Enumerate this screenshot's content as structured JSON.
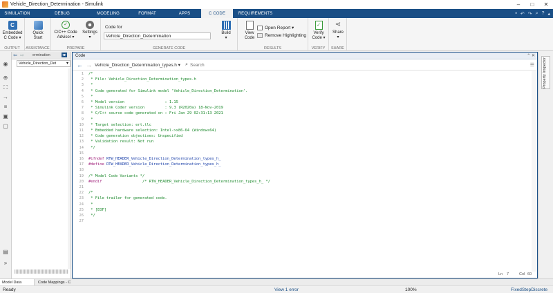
{
  "window": {
    "title": "Vehicle_Direction_Determination - Simulink",
    "controls": [
      "–",
      "□",
      "✕"
    ]
  },
  "tabs": [
    {
      "label": "SIMULATION",
      "active": false
    },
    {
      "label": "DEBUG",
      "active": false
    },
    {
      "label": "MODELING",
      "active": false
    },
    {
      "label": "FORMAT",
      "active": false
    },
    {
      "label": "APPS",
      "active": false
    },
    {
      "label": "C CODE",
      "active": true
    },
    {
      "label": "REQUIREMENTS",
      "active": false
    }
  ],
  "toolstrip": {
    "output": {
      "label": "OUTPUT",
      "embedded_line1": "Embedded",
      "embedded_line2": "C Code ▾"
    },
    "assistance": {
      "label": "ASSISTANCE",
      "quick_line1": "Quick",
      "quick_line2": "Start"
    },
    "prepare": {
      "label": "PREPARE",
      "advisor_line1": "C/C++ Code",
      "advisor_line2": "Advisor ▾",
      "settings_line1": "Settings",
      "settings_line2": "▾"
    },
    "generate": {
      "label": "GENERATE CODE",
      "code_for_label": "Code for",
      "code_for_value": "Vehicle_Direction_Determination",
      "build_line1": "Build",
      "build_line2": "▾"
    },
    "results": {
      "label": "RESULTS",
      "view_line1": "View",
      "view_line2": "Code",
      "open_report": "Open Report ▾",
      "remove_highlighting": "Remove Highlighting"
    },
    "verify": {
      "label": "VERIFY",
      "verify_line1": "Verify",
      "verify_line2": "Code ▾"
    },
    "share": {
      "label": "SHARE",
      "share_line1": "Share",
      "share_line2": "▾"
    }
  },
  "browser": {
    "breadcrumb": "ermination",
    "model_selector": "Vehicle_Direction_Det"
  },
  "code_panel": {
    "header": "Code",
    "file_selector": "Vehicle_Direction_Determination_types.h ▾",
    "search_placeholder": "Search",
    "lines": [
      {
        "n": "1",
        "text": "/*",
        "cls": "c-comment"
      },
      {
        "n": "2",
        "text": " * File: Vehicle_Direction_Determination_types.h",
        "cls": "c-comment"
      },
      {
        "n": "3",
        "text": " *",
        "cls": "c-comment"
      },
      {
        "n": "4",
        "text": " * Code generated for Simulink model 'Vehicle_Direction_Determination'.",
        "cls": "c-comment"
      },
      {
        "n": "5",
        "text": " *",
        "cls": "c-comment"
      },
      {
        "n": "6",
        "text": " * Model version                  : 1.15",
        "cls": "c-comment"
      },
      {
        "n": "7",
        "text": " * Simulink Coder version         : 9.3 (R2020a) 18-Nov-2019",
        "cls": "c-comment"
      },
      {
        "n": "8",
        "text": " * C/C++ source code generated on : Fri Jan 29 02:31:13 2021",
        "cls": "c-comment"
      },
      {
        "n": "9",
        "text": " *",
        "cls": "c-comment"
      },
      {
        "n": "10",
        "text": " * Target selection: ert.tlc",
        "cls": "c-comment"
      },
      {
        "n": "11",
        "text": " * Embedded hardware selection: Intel->x86-64 (Windows64)",
        "cls": "c-comment"
      },
      {
        "n": "12",
        "text": " * Code generation objectives: Unspecified",
        "cls": "c-comment"
      },
      {
        "n": "13",
        "text": " * Validation result: Not run",
        "cls": "c-comment"
      },
      {
        "n": "14",
        "text": " */",
        "cls": "c-comment"
      },
      {
        "n": "15",
        "text": "",
        "cls": ""
      },
      {
        "n": "16",
        "pp": "#ifndef",
        "macro": " RTW_HEADER_Vehicle_Direction_Determination_types_h_"
      },
      {
        "n": "17",
        "pp": "#define",
        "macro": " RTW_HEADER_Vehicle_Direction_Determination_types_h_"
      },
      {
        "n": "18",
        "text": "",
        "cls": ""
      },
      {
        "n": "19",
        "text": "/* Model Code Variants */",
        "cls": "c-comment"
      },
      {
        "n": "20",
        "pp": "#endif",
        "comment": "                  /* RTW_HEADER_Vehicle_Direction_Determination_types_h_ */"
      },
      {
        "n": "21",
        "text": "",
        "cls": ""
      },
      {
        "n": "22",
        "text": "/*",
        "cls": "c-comment"
      },
      {
        "n": "23",
        "text": " * File trailer for generated code.",
        "cls": "c-comment"
      },
      {
        "n": "24",
        "text": " *",
        "cls": "c-comment"
      },
      {
        "n": "25",
        "text": " * [EOF]",
        "cls": "c-comment"
      },
      {
        "n": "26",
        "text": " */",
        "cls": "c-comment"
      },
      {
        "n": "27",
        "text": "",
        "cls": ""
      }
    ],
    "status_ln_label": "Ln",
    "status_ln": "7",
    "status_col_label": "Col",
    "status_col": "60"
  },
  "property_inspector": "Property Inspector",
  "bottom_tabs": [
    "Model Data Editor",
    "Code Mappings - C"
  ],
  "status": {
    "left": "Ready",
    "center": "View 1 error",
    "zoom": "100%",
    "solver": "FixedStepDiscrete"
  }
}
